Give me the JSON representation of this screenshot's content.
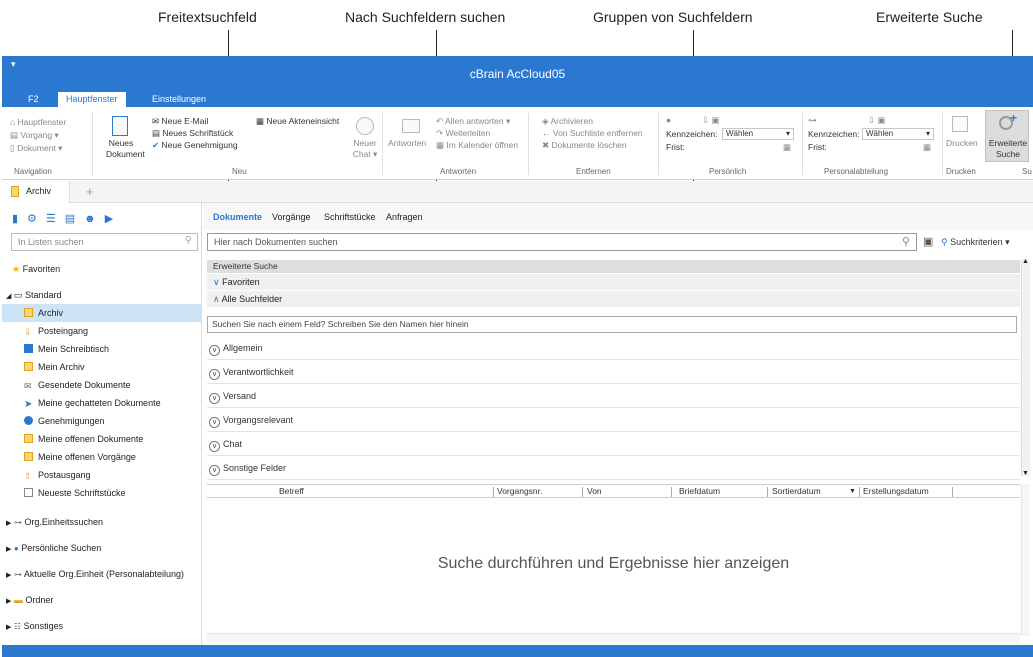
{
  "callouts": {
    "freitext": "Freitextsuchfeld",
    "nach_suchfeldern": "Nach Suchfeldern suchen",
    "gruppen": "Gruppen von Suchfeldern",
    "erweiterte": "Erweiterte Suche"
  },
  "window": {
    "title": "cBrain AcCloud05",
    "quick_access": "▾"
  },
  "ribbon_tabs": [
    "F2",
    "Hauptfenster",
    "Einstellungen"
  ],
  "ribbon": {
    "nav": {
      "hauptfenster": "Hauptfenster",
      "vorgang": "Vorgang ▾",
      "dokument": "Dokument ▾",
      "group": "Navigation"
    },
    "neu": {
      "neues_dokument_1": "Neues",
      "neues_dokument_2": "Dokument",
      "neue_email": "Neue E-Mail",
      "neues_schriftstueck": "Neues Schriftstück",
      "neue_genehmigung": "Neue Genehmigung",
      "neue_akteneinsicht": "Neue Akteneinsicht",
      "neuer_chat_1": "Neuer",
      "neuer_chat_2": "Chat ▾",
      "group": "Neu"
    },
    "antworten": {
      "antworten": "Antworten",
      "allen_antworten": "Allen antworten ▾",
      "weiterleiten": "Weiterleiten",
      "im_kalender": "Im Kalender öffnen",
      "group": "Antworten"
    },
    "entfernen": {
      "archivieren": "Archivieren",
      "von_suchliste": "Von Suchliste entfernen",
      "dokumente_loeschen": "Dokumente löschen",
      "group": "Entfernen"
    },
    "persoenlich": {
      "kennzeichen": "Kennzeichen:",
      "waehlen": "Wählen",
      "frist": "Frist:",
      "group": "Persönlich"
    },
    "personalabteilung": {
      "kennzeichen": "Kennzeichen:",
      "waehlen": "Wählen",
      "frist": "Frist:",
      "group": "Personalabteilung"
    },
    "drucken": {
      "label": "Drucken",
      "group": "Drucken"
    },
    "erweiterte_suche": {
      "line1": "Erweiterte",
      "line2": "Suche",
      "group": "Su"
    }
  },
  "doc_tabs": {
    "archiv": "Archiv",
    "add": "+"
  },
  "left": {
    "search_placeholder": "In Listen suchen",
    "favoriten": "Favoriten",
    "standard": "Standard",
    "items": [
      "Archiv",
      "Posteingang",
      "Mein Schreibtisch",
      "Mein Archiv",
      "Gesendete Dokumente",
      "Meine gechatteten Dokumente",
      "Genehmigungen",
      "Meine offenen Dokumente",
      "Meine offenen Vorgänge",
      "Postausgang",
      "Neueste Schriftstücke"
    ],
    "groups": [
      "Org.Einheitssuchen",
      "Persönliche Suchen",
      "Aktuelle Org.Einheit (Personalabteilung)",
      "Ordner",
      "Sonstiges"
    ]
  },
  "main": {
    "tabs": [
      "Dokumente",
      "Vorgänge",
      "Schriftstücke",
      "Anfragen"
    ],
    "search_placeholder": "Hier nach Dokumenten suchen",
    "suchkriterien": "Suchkriterien",
    "erweiterte_suche_header": "Erweiterte Suche",
    "favoriten": "Favoriten",
    "alle_suchfelder": "Alle Suchfelder",
    "field_search_placeholder": "Suchen Sie nach einem Feld? Schreiben Sie den Namen hier hinein",
    "field_groups": [
      "Allgemein",
      "Verantwortlichkeit",
      "Versand",
      "Vorgangsrelevant",
      "Chat",
      "Sonstige Felder"
    ],
    "columns": [
      "Betreff",
      "Vorgangsnr.",
      "Von",
      "Briefdatum",
      "Sortierdatum",
      "Erstellungsdatum"
    ],
    "empty_message": "Suche durchführen und Ergebnisse hier anzeigen"
  },
  "colors": {
    "accent": "#2b78d0",
    "selected": "#cde4f7"
  }
}
